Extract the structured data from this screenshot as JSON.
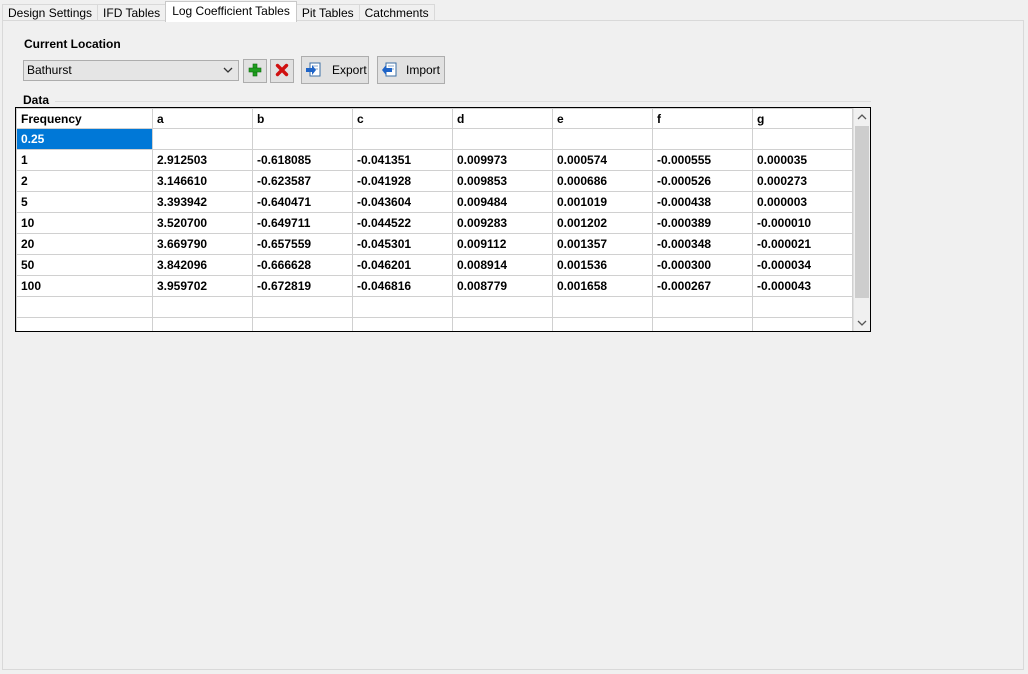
{
  "tabs": [
    {
      "label": "Design Settings",
      "active": false
    },
    {
      "label": "IFD Tables",
      "active": false
    },
    {
      "label": "Log Coefficient Tables",
      "active": true
    },
    {
      "label": "Pit Tables",
      "active": false
    },
    {
      "label": "Catchments",
      "active": false
    }
  ],
  "location": {
    "heading": "Current Location",
    "selected": "Bathurst",
    "add_icon": "green-plus-icon",
    "delete_icon": "red-x-icon",
    "export_label": "Export",
    "import_label": "Import"
  },
  "data_section": {
    "heading": "Data",
    "columns": [
      "Frequency",
      "a",
      "b",
      "c",
      "d",
      "e",
      "f",
      "g"
    ],
    "rows": [
      [
        "0.25",
        "",
        "",
        "",
        "",
        "",
        "",
        ""
      ],
      [
        "1",
        "2.912503",
        "-0.618085",
        "-0.041351",
        "0.009973",
        "0.000574",
        "-0.000555",
        "0.000035"
      ],
      [
        "2",
        "3.146610",
        "-0.623587",
        "-0.041928",
        "0.009853",
        "0.000686",
        "-0.000526",
        "0.000273"
      ],
      [
        "5",
        "3.393942",
        "-0.640471",
        "-0.043604",
        "0.009484",
        "0.001019",
        "-0.000438",
        "0.000003"
      ],
      [
        "10",
        "3.520700",
        "-0.649711",
        "-0.044522",
        "0.009283",
        "0.001202",
        "-0.000389",
        "-0.000010"
      ],
      [
        "20",
        "3.669790",
        "-0.657559",
        "-0.045301",
        "0.009112",
        "0.001357",
        "-0.000348",
        "-0.000021"
      ],
      [
        "50",
        "3.842096",
        "-0.666628",
        "-0.046201",
        "0.008914",
        "0.001536",
        "-0.000300",
        "-0.000034"
      ],
      [
        "100",
        "3.959702",
        "-0.672819",
        "-0.046816",
        "0.008779",
        "0.001658",
        "-0.000267",
        "-0.000043"
      ],
      [
        "",
        "",
        "",
        "",
        "",
        "",
        "",
        ""
      ],
      [
        "",
        "",
        "",
        "",
        "",
        "",
        "",
        ""
      ]
    ],
    "selected_cell": [
      0,
      0
    ]
  },
  "colors": {
    "selection": "#0078d7",
    "add_icon": "#1f9e1f",
    "delete_icon": "#d01010"
  }
}
